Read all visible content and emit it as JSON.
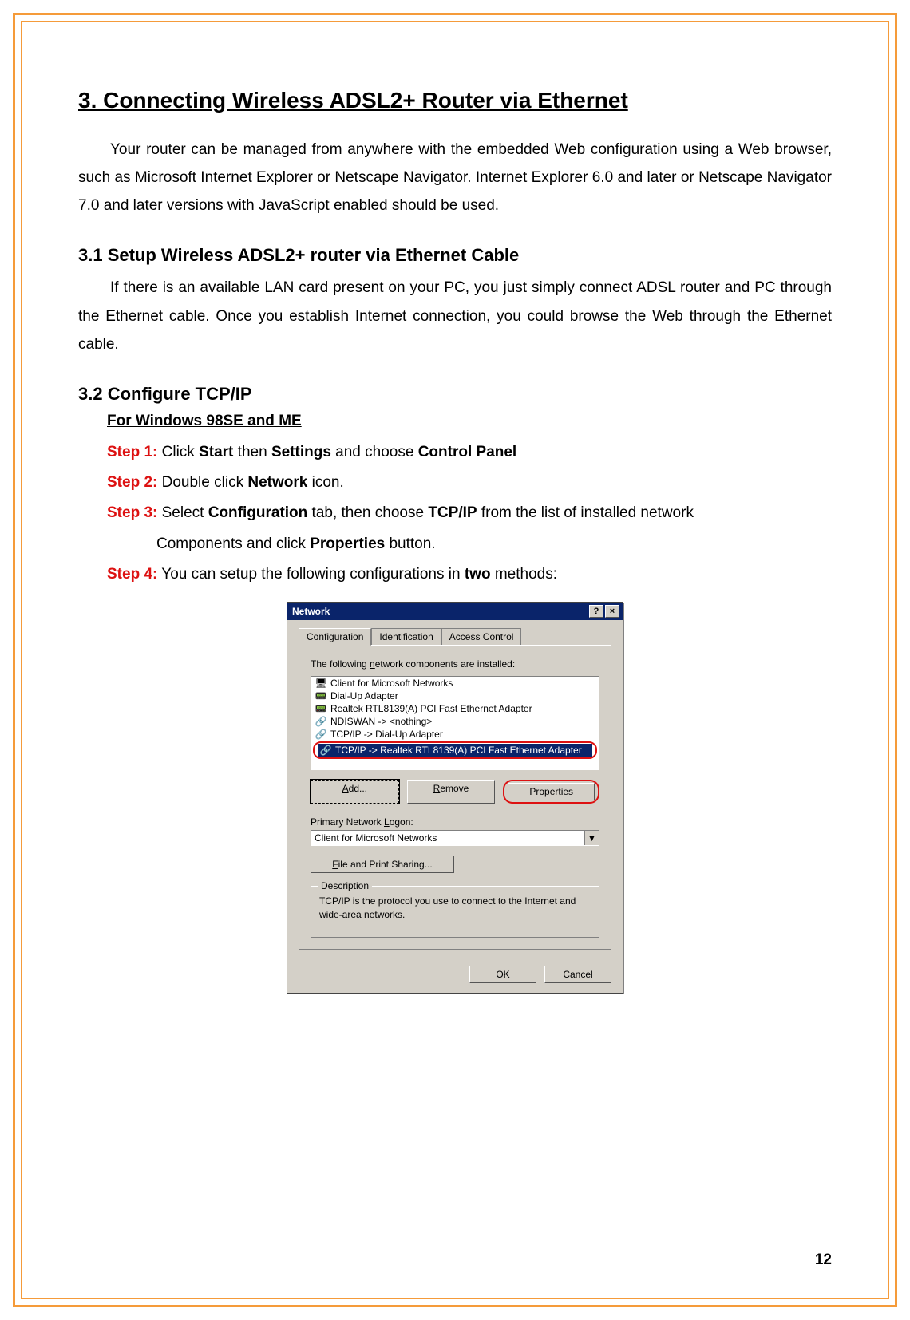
{
  "heading": "3. Connecting Wireless ADSL2+ Router via Ethernet",
  "intro": "Your router can be managed from anywhere with the embedded Web configuration using a Web browser, such as Microsoft Internet Explorer or Netscape Navigator. Internet Explorer 6.0 and later or Netscape Navigator 7.0 and later versions with JavaScript enabled should be used.",
  "section31_title": "3.1 Setup Wireless ADSL2+ router via Ethernet Cable",
  "section31_body": "If there is an available LAN card present on your PC, you just simply connect ADSL router and PC through the Ethernet cable. Once you establish Internet connection, you could browse the Web through the Ethernet cable.",
  "section32_title": "3.2 Configure TCP/IP",
  "sub_heading": "For Windows 98SE and ME",
  "steps": {
    "s1": {
      "label": "Step 1:",
      "a": " Click ",
      "b": "Start",
      "c": " then ",
      "d": "Settings",
      "e": " and choose ",
      "f": "Control Panel"
    },
    "s2": {
      "label": "Step 2:",
      "a": " Double click ",
      "b": "Network",
      "c": " icon."
    },
    "s3": {
      "label": "Step 3:",
      "a": " Select ",
      "b": "Configuration",
      "c": " tab, then choose ",
      "d": "TCP/IP",
      "e": " from the list of installed network",
      "f": "Components and click ",
      "g": "Properties",
      "h": " button."
    },
    "s4": {
      "label": "Step 4:",
      "a": " You can setup the following configurations in ",
      "b": "two",
      "c": " methods:"
    }
  },
  "dialog": {
    "title": "Network",
    "help_btn": "?",
    "close_btn": "×",
    "tabs": [
      "Configuration",
      "Identification",
      "Access Control"
    ],
    "instr_pre": "The following ",
    "instr_u": "n",
    "instr_post": "etwork components are installed:",
    "list": [
      "Client for Microsoft Networks",
      "Dial-Up Adapter",
      "Realtek RTL8139(A) PCI Fast Ethernet Adapter",
      "NDISWAN -> <nothing>",
      "TCP/IP -> Dial-Up Adapter",
      "TCP/IP -> Realtek RTL8139(A) PCI Fast Ethernet Adapter"
    ],
    "add_u": "A",
    "add_post": "dd...",
    "remove_u": "R",
    "remove_post": "emove",
    "properties_u": "P",
    "properties_post": "roperties",
    "logon_label_pre": "Primary Network ",
    "logon_label_u": "L",
    "logon_label_post": "ogon:",
    "logon_value": "Client for Microsoft Networks",
    "share_u": "F",
    "share_post": "ile and Print Sharing...",
    "desc_legend": "Description",
    "desc_text": "TCP/IP is the protocol you use to connect to the Internet and wide-area networks.",
    "ok": "OK",
    "cancel": "Cancel"
  },
  "page_number": "12"
}
